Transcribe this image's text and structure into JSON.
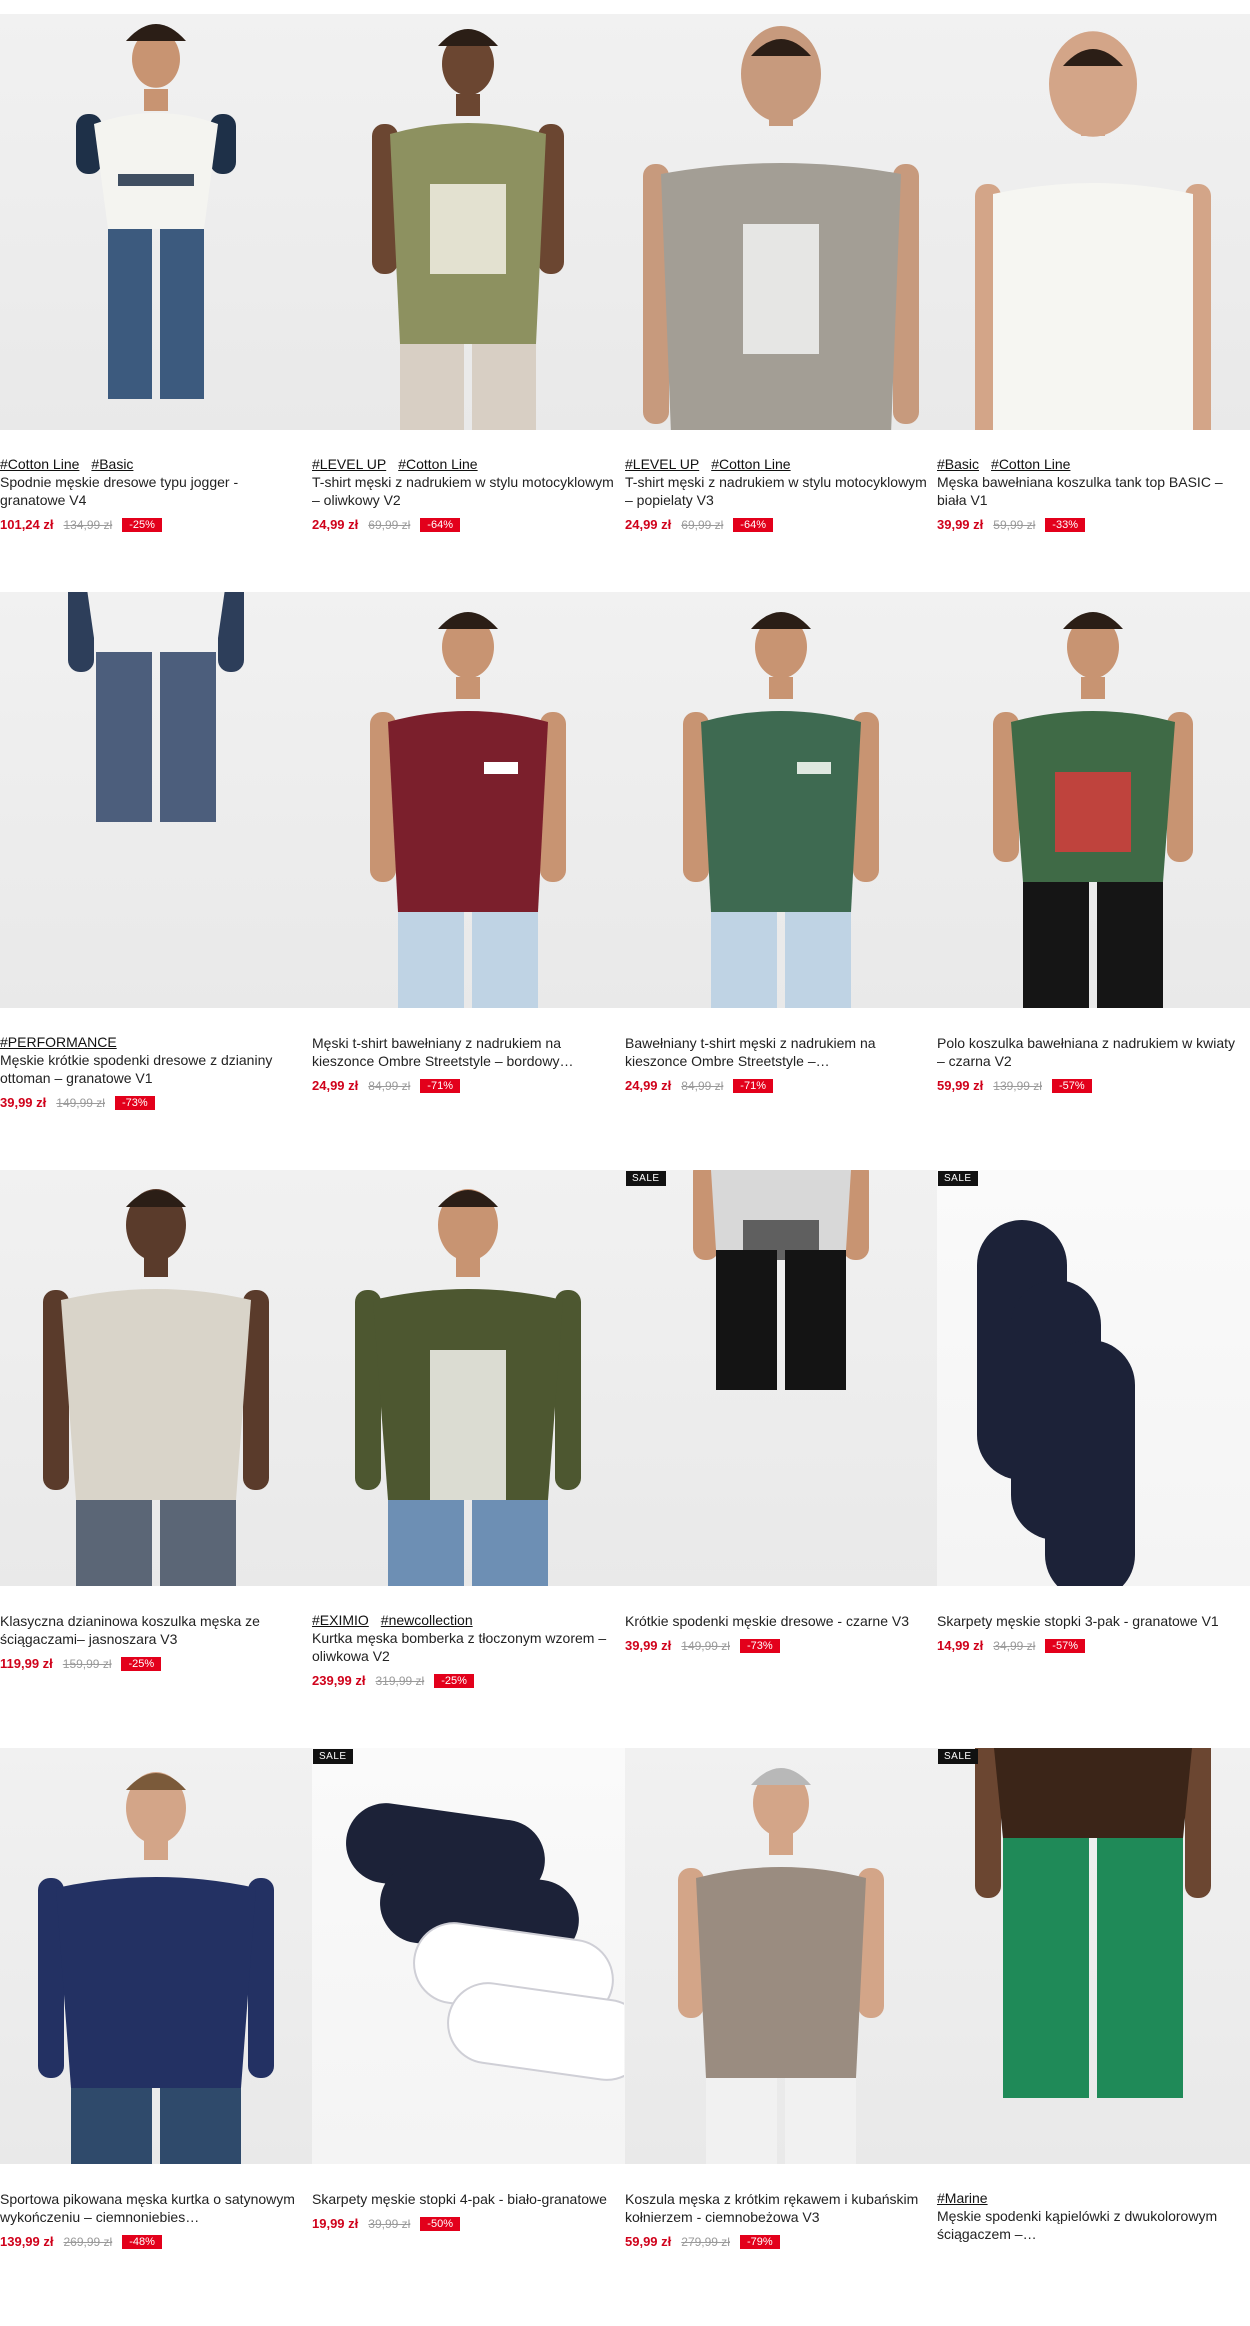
{
  "badge_label": "SALE",
  "products": [
    {
      "tags": [
        "#Cotton Line",
        "#Basic"
      ],
      "title": "Spodnie męskie dresowe typu jogger - granatowe V4",
      "price": "101,24 zł",
      "old_price": "134,99 zł",
      "discount": "-25%",
      "image": "man-white-raglan-tshirt-navy-joggers"
    },
    {
      "tags": [
        "#LEVEL UP",
        "#Cotton Line"
      ],
      "title": "T-shirt męski z nadrukiem w stylu motocyklowym – oliwkowy V2",
      "price": "24,99 zł",
      "old_price": "69,99 zł",
      "discount": "-64%",
      "image": "olive-tshirt-motor-oil-racing-print"
    },
    {
      "tags": [
        "#LEVEL UP",
        "#Cotton Line"
      ],
      "title": "T-shirt męski z nadrukiem w stylu motocyklowym – popielaty V3",
      "price": "24,99 zł",
      "old_price": "69,99 zł",
      "discount": "-64%",
      "image": "grey-tshirt-motor-oil-racing-print"
    },
    {
      "tags": [
        "#Basic",
        "#Cotton Line"
      ],
      "title": "Męska bawełniana koszulka tank top BASIC – biała V1",
      "price": "39,99 zł",
      "old_price": "59,99 zł",
      "discount": "-33%",
      "image": "white-tank-top"
    },
    {
      "tags": [
        "#PERFORMANCE"
      ],
      "title": "Męskie krótkie spodenki dresowe z dzianiny ottoman – granatowe V1",
      "price": "39,99 zł",
      "old_price": "149,99 zł",
      "discount": "-73%",
      "image": "navy-sweat-shorts"
    },
    {
      "tags": [],
      "title": "Męski t-shirt bawełniany z nadrukiem na kieszonce Ombre Streetstyle – bordowy…",
      "price": "24,99 zł",
      "old_price": "84,99 zł",
      "discount": "-71%",
      "image": "burgundy-pocket-print-tshirt"
    },
    {
      "tags": [],
      "title": "Bawełniany t-shirt męski z nadrukiem na kieszonce Ombre Streetstyle –…",
      "price": "24,99 zł",
      "old_price": "84,99 zł",
      "discount": "-71%",
      "image": "green-pocket-print-tshirt"
    },
    {
      "tags": [],
      "title": "Polo koszulka bawełniana z nadrukiem w kwiaty – czarna V2",
      "price": "59,99 zł",
      "old_price": "139,99 zł",
      "discount": "-57%",
      "image": "floral-print-polo"
    },
    {
      "tags": [],
      "title": "Klasyczna dzianinowa koszulka męska ze ściągaczami– jasnoszara V3",
      "price": "119,99 zł",
      "old_price": "159,99 zł",
      "discount": "-25%",
      "image": "light-grey-knit-tshirt"
    },
    {
      "tags": [
        "#EXIMIO",
        "#newcollection"
      ],
      "title": "Kurtka męska bomberka z tłoczonym wzorem – oliwkowa V2",
      "price": "239,99 zł",
      "old_price": "319,99 zł",
      "discount": "-25%",
      "image": "olive-quilted-bomber-jacket"
    },
    {
      "tags": [],
      "title": "Krótkie spodenki męskie dresowe - czarne V3",
      "price": "39,99 zł",
      "old_price": "149,99 zł",
      "discount": "-73%",
      "image": "black-sweat-shorts",
      "sale": true
    },
    {
      "tags": [],
      "title": "Skarpety męskie stopki 3-pak - granatowe V1",
      "price": "14,99 zł",
      "old_price": "34,99 zł",
      "discount": "-57%",
      "image": "navy-no-show-socks-3pack",
      "sale": true
    },
    {
      "tags": [],
      "title": "Sportowa pikowana męska kurtka o satynowym wykończeniu – ciemnoniebies…",
      "price": "139,99 zł",
      "old_price": "269,99 zł",
      "discount": "-48%",
      "image": "navy-puffer-jacket"
    },
    {
      "tags": [],
      "title": "Skarpety męskie stopki 4-pak - biało-granatowe",
      "price": "19,99 zł",
      "old_price": "39,99 zł",
      "discount": "-50%",
      "image": "white-navy-no-show-socks-4pack",
      "sale": true
    },
    {
      "tags": [],
      "title": "Koszula męska z krótkim rękawem i kubańskim kołnierzem - ciemnobeżowa V3",
      "price": "59,99 zł",
      "old_price": "279,99 zł",
      "discount": "-79%",
      "image": "beige-cuban-collar-shirt"
    },
    {
      "tags": [
        "#Marine"
      ],
      "title": "Męskie spodenki kąpielówki z dwukolorowym ściągaczem –…",
      "price": "",
      "old_price": "",
      "discount": "",
      "image": "green-swim-shorts",
      "sale": true
    }
  ]
}
